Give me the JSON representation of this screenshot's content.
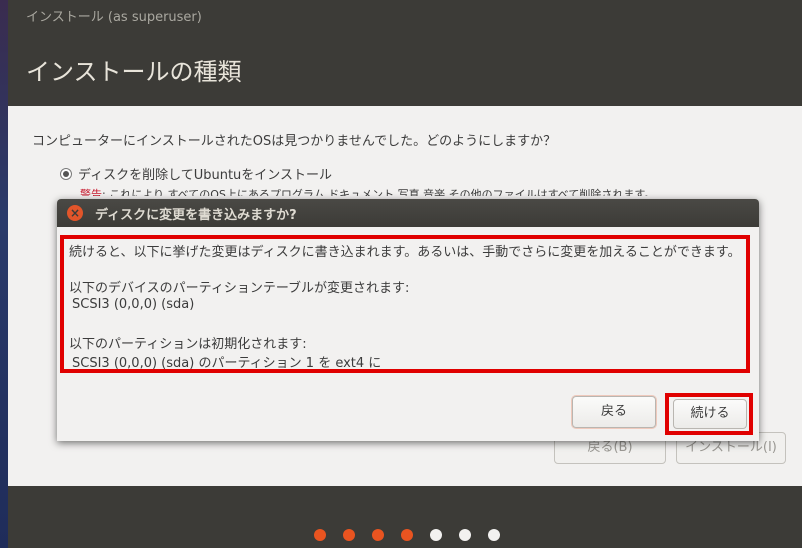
{
  "window": {
    "title": "インストール (as superuser)"
  },
  "header": {
    "page_title": "インストールの種類"
  },
  "main": {
    "question": "コンピューターにインストールされたOSは見つかりませんでした。どのようにしますか？",
    "option_label": "ディスクを削除してUbuntuをインストール",
    "warning_label": "警告",
    "warning_text": ": これにより すべてのOS上にあるプログラム ドキュメント 写真 音楽 その他のファイルはすべて削除されます。"
  },
  "background_buttons": {
    "back": "戻る(B)",
    "install": "インストール(I)"
  },
  "dialog": {
    "title": "ディスクに変更を書き込みますか?",
    "message_line1": "続けると、以下に挙げた変更はディスクに書き込まれます。あるいは、手動でさらに変更を加えることができます。",
    "devices_heading": "以下のデバイスのパーティションテーブルが変更されます:",
    "device": "SCSI3 (0,0,0) (sda)",
    "partitions_heading": "以下のパーティションは初期化されます:",
    "partition": "SCSI3 (0,0,0) (sda) のパーティション 1 を ext4 に",
    "back_button": "戻る",
    "continue_button": "続ける"
  },
  "progress": {
    "total_steps": 7,
    "completed_steps": 4,
    "active_color": "#e95420",
    "inactive_color": "#f2f1f0"
  }
}
